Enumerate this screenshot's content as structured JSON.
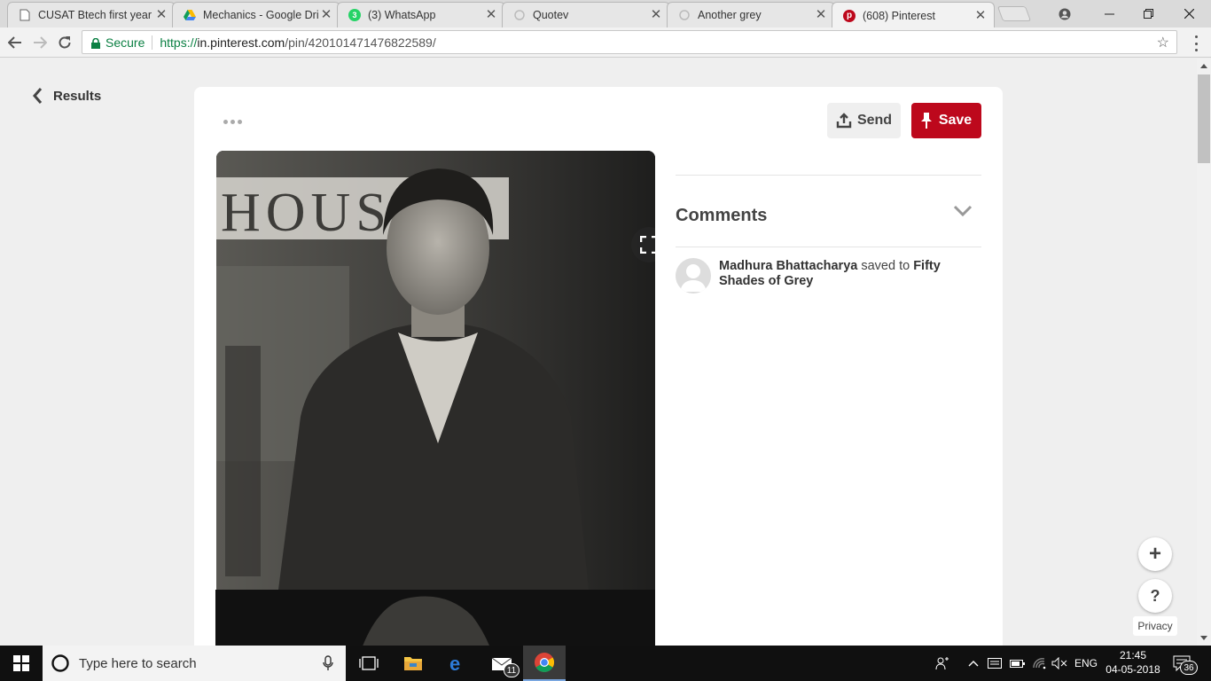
{
  "browser": {
    "tabs": [
      {
        "title": "CUSAT Btech first year n",
        "icon": "document-icon",
        "active": false
      },
      {
        "title": "Mechanics - Google Dri",
        "icon": "google-drive-icon",
        "active": false
      },
      {
        "title": "(3) WhatsApp",
        "icon": "whatsapp-icon",
        "active": false,
        "badge": "3"
      },
      {
        "title": "Quotev",
        "icon": "quotev-icon",
        "active": false
      },
      {
        "title": "Another grey",
        "icon": "quotev-icon",
        "active": false
      },
      {
        "title": "(608) Pinterest",
        "icon": "pinterest-icon",
        "active": true
      }
    ],
    "address": {
      "secure_label": "Secure",
      "url_scheme": "https://",
      "url_host": "in.pinterest.com",
      "url_path": "/pin/420101471476822589/"
    }
  },
  "page": {
    "back_label": "Results",
    "send_label": "Send",
    "save_label": "Save",
    "comments_heading": "Comments",
    "activity": {
      "user": "Madhura Bhattacharya",
      "verb": " saved to ",
      "board": "Fifty Shades of Grey"
    },
    "privacy_label": "Privacy",
    "plus_symbol": "+",
    "help_symbol": "?"
  },
  "taskbar": {
    "search_placeholder": "Type here to search",
    "mail_badge": "11",
    "language": "ENG",
    "time": "21:45",
    "date": "04-05-2018",
    "notification_count": "36"
  },
  "colors": {
    "pinterest_red": "#bd081c",
    "secure_green": "#0b8043"
  }
}
